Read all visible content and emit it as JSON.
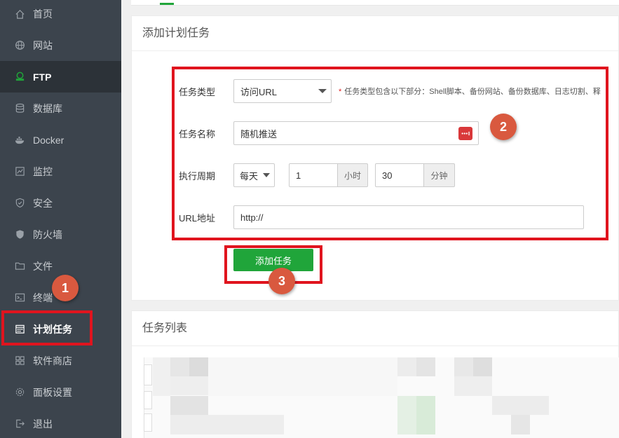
{
  "sidebar": {
    "items": [
      {
        "label": "首页",
        "icon": "home-icon"
      },
      {
        "label": "网站",
        "icon": "globe-icon"
      },
      {
        "label": "FTP",
        "icon": "ftp-icon"
      },
      {
        "label": "数据库",
        "icon": "database-icon"
      },
      {
        "label": "Docker",
        "icon": "docker-icon"
      },
      {
        "label": "监控",
        "icon": "monitor-icon"
      },
      {
        "label": "安全",
        "icon": "shield-icon"
      },
      {
        "label": "防火墙",
        "icon": "firewall-icon"
      },
      {
        "label": "文件",
        "icon": "folder-icon"
      },
      {
        "label": "终端",
        "icon": "terminal-icon"
      },
      {
        "label": "计划任务",
        "icon": "calendar-icon"
      },
      {
        "label": "软件商店",
        "icon": "apps-icon"
      },
      {
        "label": "面板设置",
        "icon": "gear-icon"
      },
      {
        "label": "退出",
        "icon": "logout-icon"
      }
    ]
  },
  "add_task": {
    "title": "添加计划任务",
    "type_label": "任务类型",
    "type_value": "访问URL",
    "type_hint_star": "*",
    "type_hint": "任务类型包含以下部分：Shell脚本、备份网站、备份数据库、日志切割、释",
    "name_label": "任务名称",
    "name_value": "随机推送",
    "period_label": "执行周期",
    "period_value": "每天",
    "hour_value": "1",
    "hour_unit": "小时",
    "minute_value": "30",
    "minute_unit": "分钟",
    "url_label": "URL地址",
    "url_value": "http://",
    "submit_label": "添加任务"
  },
  "task_list": {
    "title": "任务列表"
  },
  "annotations": {
    "badge1": "1",
    "badge2": "2",
    "badge3": "3",
    "highlight_color": "#e0141e",
    "badge_color": "#d9593f"
  },
  "colors": {
    "sidebar_bg": "#3c444d",
    "accent": "#20a53a"
  }
}
